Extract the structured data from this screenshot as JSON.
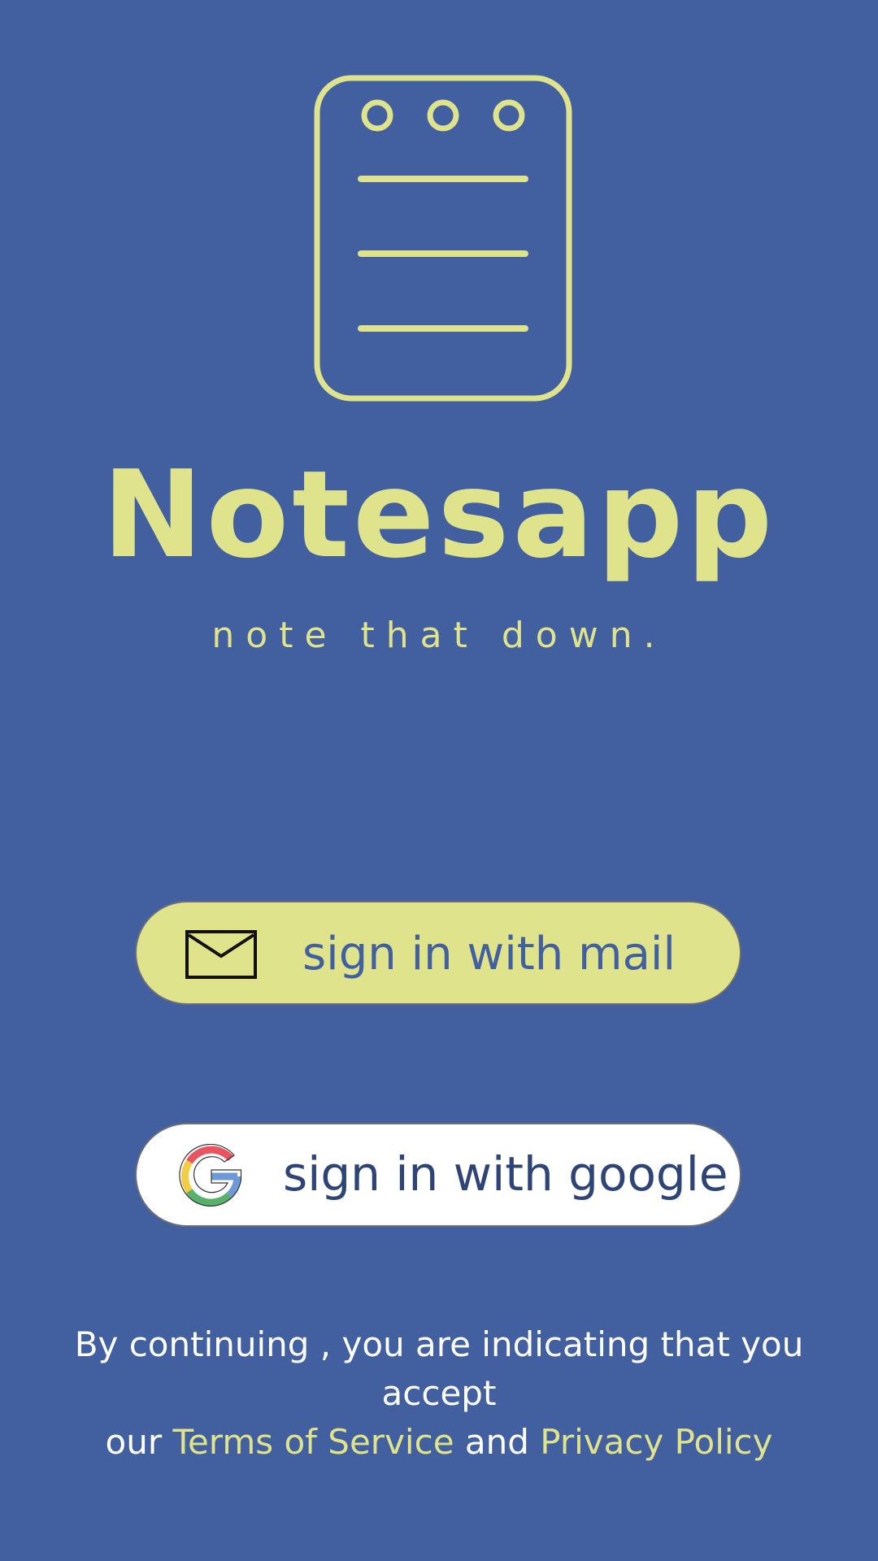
{
  "app": {
    "title": "Notesapp",
    "tagline": "note that down."
  },
  "buttons": {
    "mail": {
      "label": "sign in with mail",
      "icon": "envelope-icon"
    },
    "google": {
      "label": "sign in with google",
      "icon": "google-icon"
    }
  },
  "terms": {
    "line1": "By continuing , you are indicating that you accept",
    "prefix": "our ",
    "terms_link": "Terms of Service",
    "conjunction": " and ",
    "privacy_link": "Privacy Policy"
  },
  "colors": {
    "background": "#425fa0",
    "accent": "#dfe38b",
    "white": "#ffffff"
  }
}
